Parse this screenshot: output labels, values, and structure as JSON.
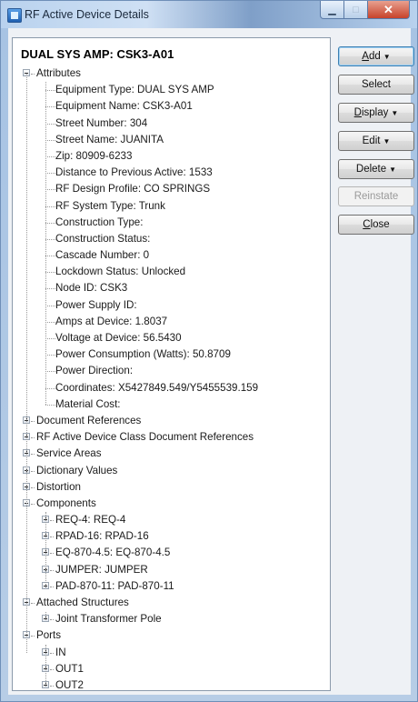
{
  "window": {
    "title": "RF Active Device Details"
  },
  "tree": {
    "header": "DUAL SYS AMP: CSK3-A01",
    "items": [
      {
        "label": "Attributes",
        "level": 0,
        "state": "expanded"
      },
      {
        "label": "Equipment Type: DUAL SYS AMP",
        "level": 1,
        "state": "leaf"
      },
      {
        "label": "Equipment Name: CSK3-A01",
        "level": 1,
        "state": "leaf"
      },
      {
        "label": "Street Number: 304",
        "level": 1,
        "state": "leaf"
      },
      {
        "label": "Street Name: JUANITA",
        "level": 1,
        "state": "leaf"
      },
      {
        "label": "Zip: 80909-6233",
        "level": 1,
        "state": "leaf"
      },
      {
        "label": "Distance to Previous Active: 1533",
        "level": 1,
        "state": "leaf"
      },
      {
        "label": "RF Design Profile: CO SPRINGS",
        "level": 1,
        "state": "leaf"
      },
      {
        "label": "RF System Type: Trunk",
        "level": 1,
        "state": "leaf"
      },
      {
        "label": "Construction Type:",
        "level": 1,
        "state": "leaf"
      },
      {
        "label": "Construction Status:",
        "level": 1,
        "state": "leaf"
      },
      {
        "label": "Cascade Number: 0",
        "level": 1,
        "state": "leaf"
      },
      {
        "label": "Lockdown Status: Unlocked",
        "level": 1,
        "state": "leaf"
      },
      {
        "label": "Node ID: CSK3",
        "level": 1,
        "state": "leaf"
      },
      {
        "label": "Power Supply ID:",
        "level": 1,
        "state": "leaf"
      },
      {
        "label": "Amps at Device: 1.8037",
        "level": 1,
        "state": "leaf"
      },
      {
        "label": "Voltage at Device: 56.5430",
        "level": 1,
        "state": "leaf"
      },
      {
        "label": "Power Consumption (Watts): 50.8709",
        "level": 1,
        "state": "leaf"
      },
      {
        "label": "Power Direction:",
        "level": 1,
        "state": "leaf"
      },
      {
        "label": "Coordinates: X5427849.549/Y5455539.159",
        "level": 1,
        "state": "leaf"
      },
      {
        "label": "Material Cost:",
        "level": 1,
        "state": "leaf"
      },
      {
        "label": "Document References",
        "level": 0,
        "state": "collapsed"
      },
      {
        "label": "RF Active Device Class Document References",
        "level": 0,
        "state": "collapsed"
      },
      {
        "label": "Service Areas",
        "level": 0,
        "state": "collapsed"
      },
      {
        "label": "Dictionary Values",
        "level": 0,
        "state": "collapsed"
      },
      {
        "label": "Distortion",
        "level": 0,
        "state": "collapsed"
      },
      {
        "label": "Components",
        "level": 0,
        "state": "expanded"
      },
      {
        "label": "REQ-4: REQ-4",
        "level": 1,
        "state": "collapsed"
      },
      {
        "label": "RPAD-16: RPAD-16",
        "level": 1,
        "state": "collapsed"
      },
      {
        "label": "EQ-870-4.5: EQ-870-4.5",
        "level": 1,
        "state": "collapsed"
      },
      {
        "label": "JUMPER: JUMPER",
        "level": 1,
        "state": "collapsed"
      },
      {
        "label": "PAD-870-11: PAD-870-11",
        "level": 1,
        "state": "collapsed"
      },
      {
        "label": "Attached Structures",
        "level": 0,
        "state": "expanded"
      },
      {
        "label": "Joint Transformer Pole",
        "level": 1,
        "state": "collapsed"
      },
      {
        "label": "Ports",
        "level": 0,
        "state": "expanded"
      },
      {
        "label": "IN",
        "level": 1,
        "state": "collapsed"
      },
      {
        "label": "OUT1",
        "level": 1,
        "state": "collapsed"
      },
      {
        "label": "OUT2",
        "level": 1,
        "state": "collapsed"
      }
    ]
  },
  "buttons": [
    {
      "name": "add-button",
      "label": "Add",
      "mnemonic_index": 0,
      "dropdown": true,
      "enabled": true,
      "default": true
    },
    {
      "name": "select-button",
      "label": "Select",
      "mnemonic_index": -1,
      "dropdown": false,
      "enabled": true,
      "default": false
    },
    {
      "name": "display-button",
      "label": "Display",
      "mnemonic_index": 0,
      "dropdown": true,
      "enabled": true,
      "default": false
    },
    {
      "name": "edit-button",
      "label": "Edit",
      "mnemonic_index": -1,
      "dropdown": true,
      "enabled": true,
      "default": false
    },
    {
      "name": "delete-button",
      "label": "Delete",
      "mnemonic_index": -1,
      "dropdown": true,
      "enabled": true,
      "default": false
    },
    {
      "name": "reinstate-button",
      "label": "Reinstate",
      "mnemonic_index": -1,
      "dropdown": false,
      "enabled": false,
      "default": false
    },
    {
      "name": "close-button",
      "label": "Close",
      "mnemonic_index": 0,
      "dropdown": false,
      "enabled": true,
      "default": false
    }
  ]
}
